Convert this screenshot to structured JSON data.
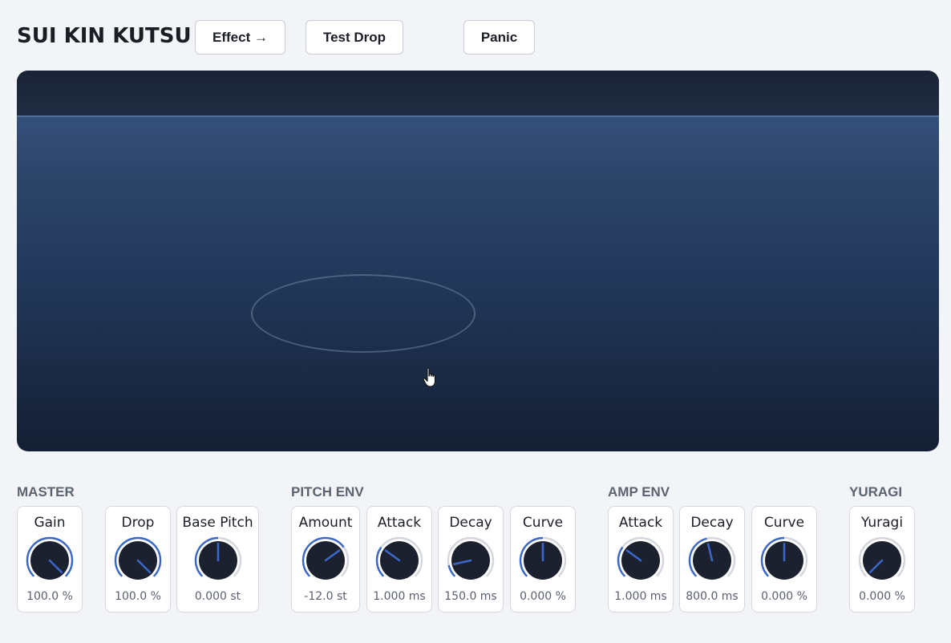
{
  "header": {
    "title": "SUI KIN KUTSU",
    "buttons": {
      "effect": "Effect →",
      "test_drop": "Test Drop",
      "panic": "Panic"
    }
  },
  "colors": {
    "accent": "#3a66c8",
    "knob_body": "#1c2130",
    "track": "#d3d6dc"
  },
  "sections": {
    "master": "MASTER",
    "pitch_env": "PITCH ENV",
    "amp_env": "AMP ENV",
    "yuragi": "YURAGI"
  },
  "knobs": {
    "gain": {
      "label": "Gain",
      "value": "100.0 %",
      "level": 1.0
    },
    "drop": {
      "label": "Drop",
      "value": "100.0 %",
      "level": 1.0
    },
    "base_pitch": {
      "label": "Base Pitch",
      "value": "0.000 st",
      "level": 0.5
    },
    "pitch_amount": {
      "label": "Amount",
      "value": "-12.0 st",
      "level": 0.7
    },
    "pitch_attack": {
      "label": "Attack",
      "value": "1.000 ms",
      "level": 0.3
    },
    "pitch_decay": {
      "label": "Decay",
      "value": "150.0 ms",
      "level": 0.12
    },
    "pitch_curve": {
      "label": "Curve",
      "value": "0.000 %",
      "level": 0.5
    },
    "amp_attack": {
      "label": "Attack",
      "value": "1.000 ms",
      "level": 0.3
    },
    "amp_decay": {
      "label": "Decay",
      "value": "800.0 ms",
      "level": 0.45
    },
    "amp_curve": {
      "label": "Curve",
      "value": "0.000 %",
      "level": 0.5
    },
    "yuragi": {
      "label": "Yuragi",
      "value": "0.000 %",
      "level": 0.0
    }
  }
}
